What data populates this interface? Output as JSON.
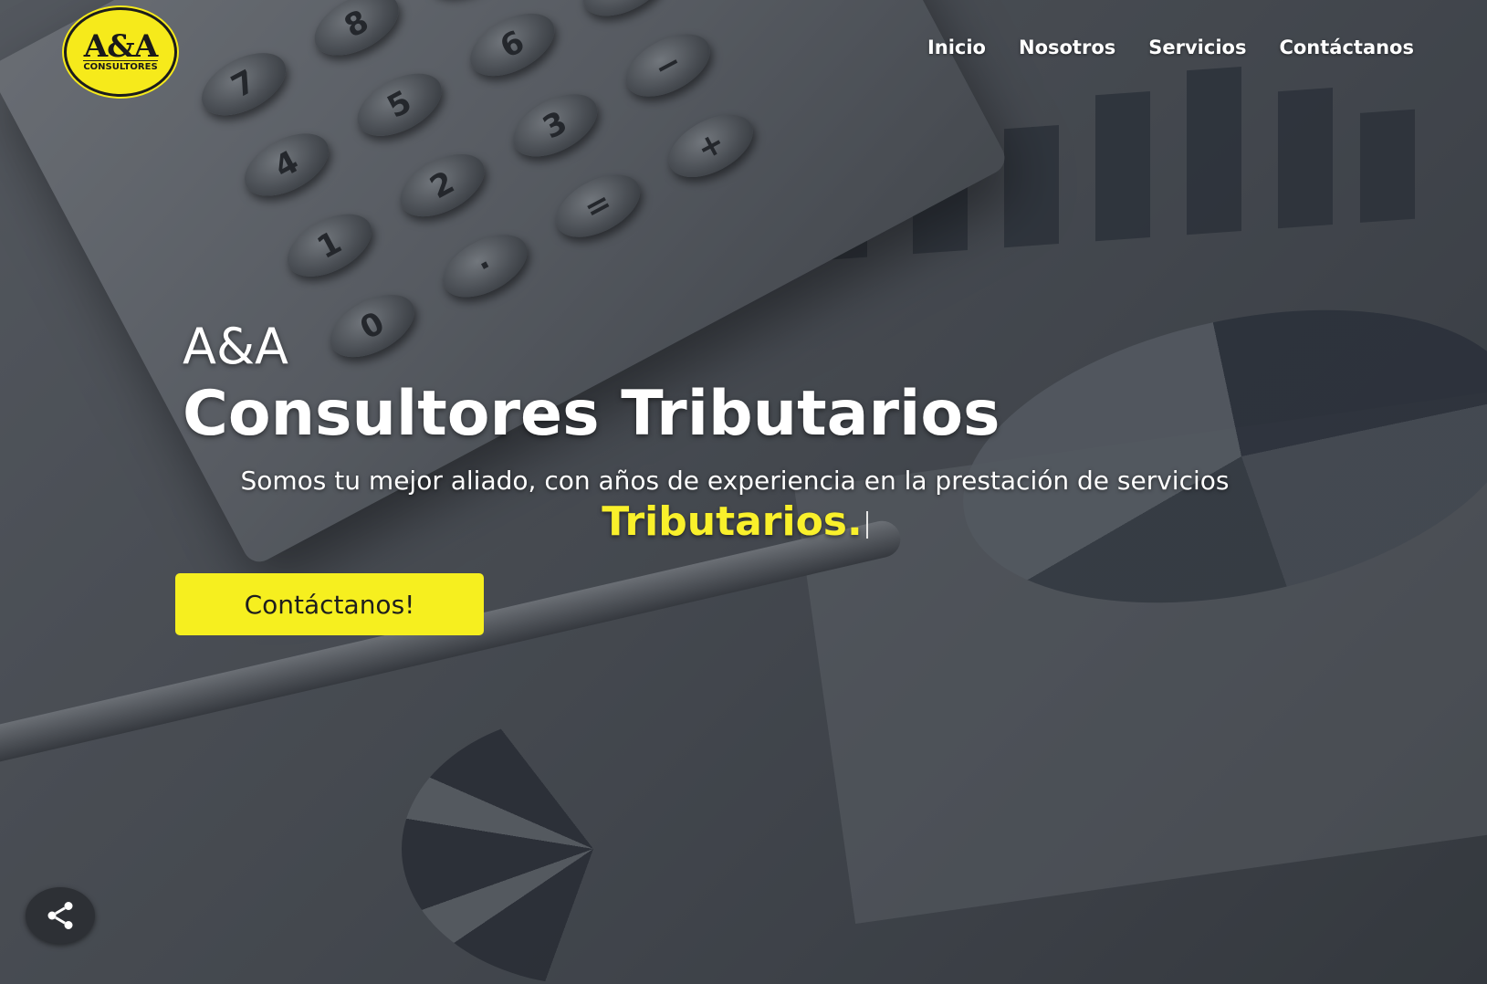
{
  "brand": {
    "logo_main": "A&A",
    "logo_sub": "CONSULTORES",
    "logo_color": "#f6ea1b"
  },
  "nav": {
    "items": [
      {
        "label": "Inicio"
      },
      {
        "label": "Nosotros"
      },
      {
        "label": "Servicios"
      },
      {
        "label": "Contáctanos"
      }
    ]
  },
  "hero": {
    "kicker": "A&A",
    "title": "Consultores Tributarios",
    "subtitle": "Somos tu mejor aliado, con años de experiencia en la prestación de servicios",
    "highlight": "Tributarios.",
    "highlight_color": "#f9f02b",
    "cta_label": "Contáctanos!",
    "cta_color": "#f6ef1f"
  },
  "share": {
    "icon": "share-icon"
  }
}
